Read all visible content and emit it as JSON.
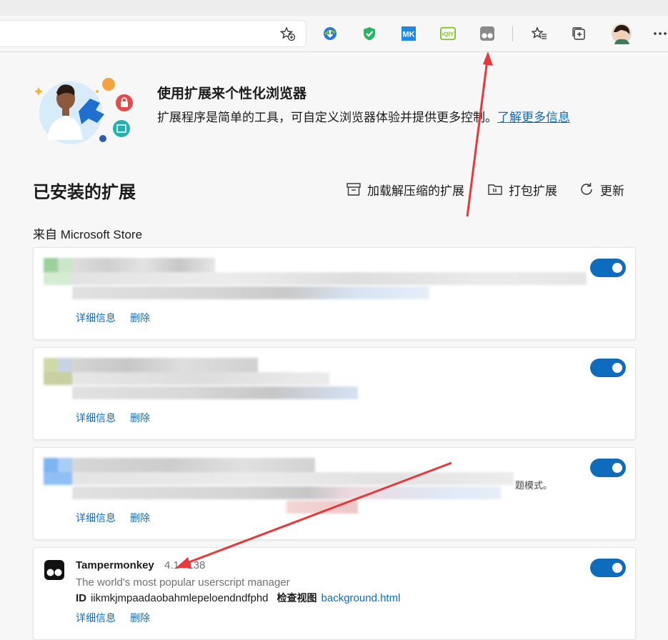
{
  "toolbar": {
    "icons": [
      "favorite-add-icon",
      "ext-download-icon",
      "ext-shield-icon",
      "ext-mk-icon",
      "ext-iqiyi-icon",
      "ext-tampermonkey-icon",
      "favorites-icon",
      "collections-icon",
      "profile-avatar",
      "more-icon"
    ],
    "mk_label": "MK",
    "iqiyi_label": "iQIY"
  },
  "hero": {
    "title": "使用扩展来个性化浏览器",
    "description": "扩展程序是简单的工具，可自定义浏览器体验并提供更多控制。",
    "link": "了解更多信息"
  },
  "installed": {
    "title": "已安装的扩展",
    "actions": [
      {
        "icon": "archive-icon",
        "label": "加载解压缩的扩展"
      },
      {
        "icon": "package-icon",
        "label": "打包扩展"
      },
      {
        "icon": "refresh-icon",
        "label": "更新"
      }
    ],
    "source_label": "来自 Microsoft Store"
  },
  "cards": [
    {
      "details": "详细信息",
      "remove": "删除",
      "enabled": true
    },
    {
      "details": "详细信息",
      "remove": "删除",
      "enabled": true
    },
    {
      "details": "详细信息",
      "remove": "删除",
      "enabled": true,
      "visible_fragment": "题模式。"
    },
    {
      "name": "Tampermonkey",
      "version": "4.1",
      "version_tail": "138",
      "description": "The world's most popular userscript manager",
      "id_label": "ID",
      "id_value": "iikmkjmpaadaobahmlepeloendndfphd",
      "inspect_label": "检查视图",
      "inspect_link": "background.html",
      "details": "详细信息",
      "remove": "删除",
      "enabled": true
    }
  ],
  "colors": {
    "accent": "#0f6cbd",
    "annotation_arrow": "#e8383a"
  }
}
